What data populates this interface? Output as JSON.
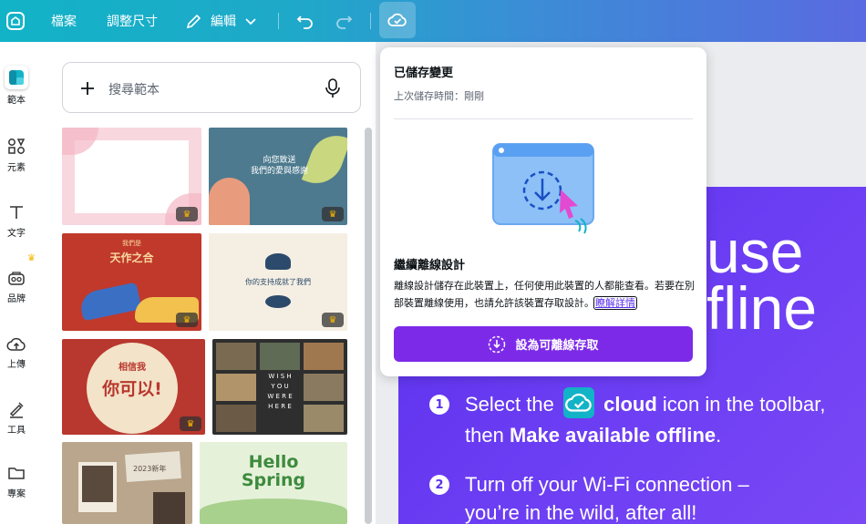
{
  "topbar": {
    "file_label": "檔案",
    "resize_label": "調整尺寸",
    "edit_label": "編輯"
  },
  "rail": [
    {
      "label": "範本",
      "icon": "template-icon"
    },
    {
      "label": "元素",
      "icon": "elements-icon"
    },
    {
      "label": "文字",
      "icon": "text-icon"
    },
    {
      "label": "品牌",
      "icon": "brand-icon"
    },
    {
      "label": "上傳",
      "icon": "upload-icon"
    },
    {
      "label": "工具",
      "icon": "tools-icon"
    },
    {
      "label": "專案",
      "icon": "projects-icon"
    }
  ],
  "search": {
    "placeholder": "搜尋範本"
  },
  "templates": [
    {
      "name": "pink-floral-frame",
      "text": ""
    },
    {
      "name": "teal-thanks",
      "text": "向您致送\n我們的愛與感謝"
    },
    {
      "name": "red-shoes",
      "text": "天作之合",
      "small": "我們是"
    },
    {
      "name": "lotus-support",
      "text": "你的支持成就了我們"
    },
    {
      "name": "red-believe",
      "text": "你可以!",
      "small": "相信我"
    },
    {
      "name": "wish-grid",
      "text": "W I S H\nY O U\nW E R E\nH E R E"
    },
    {
      "name": "photo-collage",
      "text": "2023新年"
    },
    {
      "name": "hello-spring",
      "text": "Hello\nSpring"
    }
  ],
  "popover": {
    "title": "已儲存變更",
    "last_saved": "上次儲存時間：剛剛",
    "heading": "繼續離線設計",
    "body": "離線設計儲存在此裝置上，任何使用此裝置的人都能查看。若要在別部裝置離線使用，也請允許該裝置存取設計。",
    "link": "瞭解詳情",
    "button": "設為可離線存取"
  },
  "slide": {
    "line1": "use",
    "line2": "fline",
    "steps": [
      {
        "num": "1",
        "pre": "Select the",
        "bold1": "cloud",
        "mid": "icon in the toolbar, then",
        "bold2": "Make available offline",
        "post": "."
      },
      {
        "num": "2",
        "line1": "Turn off your Wi-Fi connection –",
        "line2": "you’re in the wild, after all!"
      }
    ]
  },
  "colors": {
    "accent": "#7d2ae8",
    "slide_bg": "#5a30ec",
    "crown": "#f7b500"
  }
}
